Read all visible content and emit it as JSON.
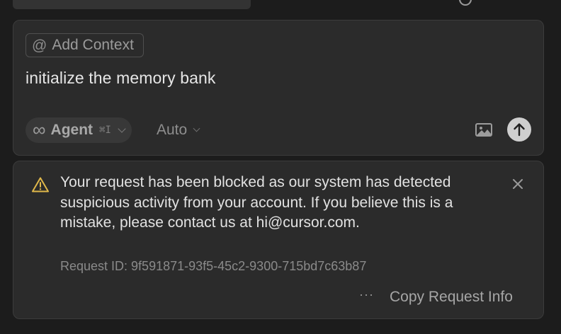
{
  "composer": {
    "add_context_label": "Add Context",
    "prompt_text": "initialize the memory bank",
    "mode_label": "Agent",
    "mode_shortcut": "⌘I",
    "model_label": "Auto",
    "icons": {
      "context": "at-icon",
      "mode": "infinity-icon",
      "mode_dropdown": "chevron-down-icon",
      "model_dropdown": "chevron-down-icon",
      "attach": "image-icon",
      "send": "arrow-up-icon"
    }
  },
  "error": {
    "message": "Your request has been blocked as our system has detected suspicious activity from your account. If you believe this is a mistake, please contact us at hi@cursor.com.",
    "request_id": "Request ID: 9f591871-93f5-45c2-9300-715bd7c63b87",
    "more_label": "···",
    "copy_label": "Copy Request Info",
    "icons": {
      "status": "warning-icon",
      "dismiss": "close-icon"
    }
  },
  "colors": {
    "background": "#1c1c1c",
    "card": "#2b2b2b",
    "warning": "#e0b84a",
    "send_button": "#cfcfcf"
  }
}
